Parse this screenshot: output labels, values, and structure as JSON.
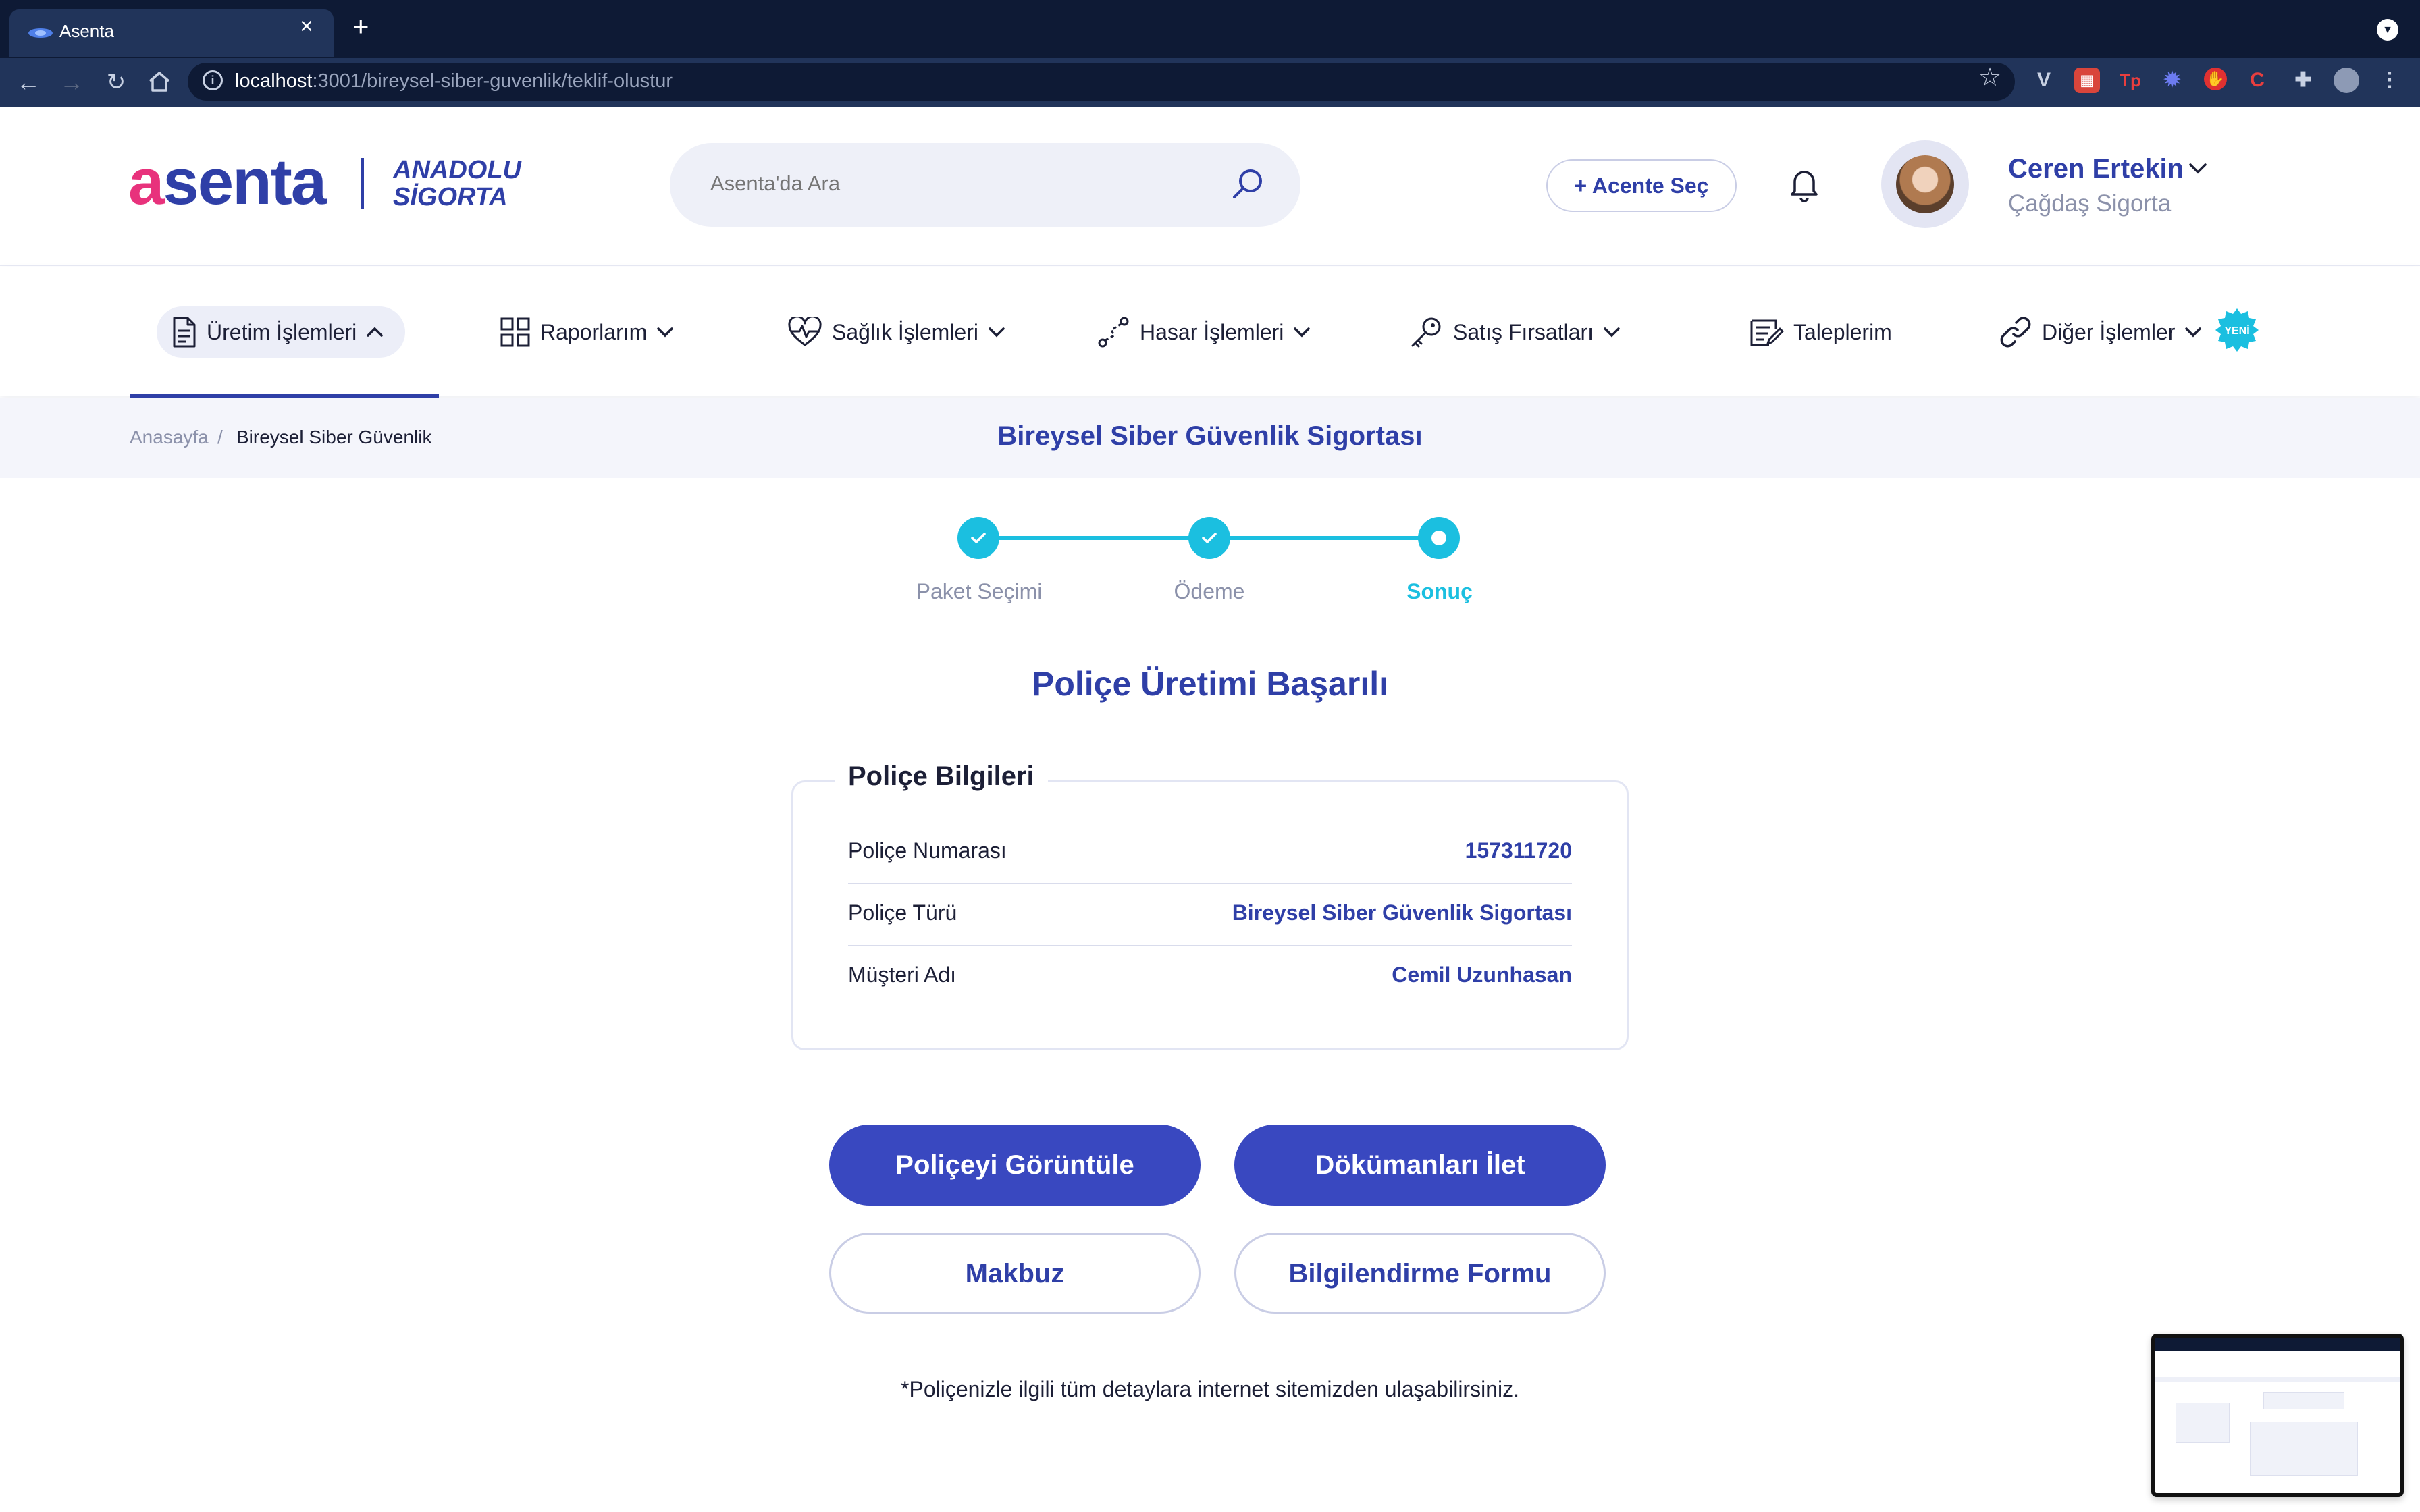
{
  "browser": {
    "tab_title": "Asenta",
    "tab_close": "×",
    "new_tab": "+",
    "url_host": "localhost",
    "url_path": ":3001/bireysel-siber-guvenlik/teklif-olustur"
  },
  "header": {
    "logo_text": "asenta",
    "partner_logo_line1": "ANADOLU",
    "partner_logo_line2": "SİGORTA",
    "search_placeholder": "Asenta'da Ara",
    "agent_button": "+ Acente Seç",
    "user_name": "Ceren Ertekin",
    "user_company": "Çağdaş Sigorta"
  },
  "nav": {
    "items": [
      {
        "label": "Üretim İşlemleri",
        "icon": "document-icon",
        "active": true
      },
      {
        "label": "Raporlarım",
        "icon": "grid-icon"
      },
      {
        "label": "Sağlık İşlemleri",
        "icon": "heart-pulse-icon"
      },
      {
        "label": "Hasar İşlemleri",
        "icon": "route-icon"
      },
      {
        "label": "Satış Fırsatları",
        "icon": "key-icon"
      },
      {
        "label": "Taleplerim",
        "icon": "note-edit-icon"
      },
      {
        "label": "Diğer İşlemler",
        "icon": "link-icon"
      }
    ],
    "new_badge": "YENİ"
  },
  "breadcrumb": {
    "home": "Anasayfa",
    "separator": "/",
    "current": "Bireysel Siber Güvenlik"
  },
  "page_title": "Bireysel Siber Güvenlik Sigortası",
  "stepper": {
    "steps": [
      {
        "label": "Paket Seçimi",
        "state": "done"
      },
      {
        "label": "Ödeme",
        "state": "done"
      },
      {
        "label": "Sonuç",
        "state": "current"
      }
    ]
  },
  "result": {
    "title": "Poliçe Üretimi Başarılı",
    "box_title": "Poliçe Bilgileri",
    "rows": [
      {
        "label": "Poliçe Numarası",
        "value": "157311720"
      },
      {
        "label": "Poliçe Türü",
        "value": "Bireysel Siber Güvenlik Sigortası"
      },
      {
        "label": "Müşteri Adı",
        "value": "Cemil Uzunhasan"
      }
    ]
  },
  "actions": {
    "view_policy": "Poliçeyi Görüntüle",
    "send_documents": "Dökümanları İlet",
    "receipt": "Makbuz",
    "info_form": "Bilgilendirme Formu"
  },
  "footnote": "*Poliçenizle ilgili tüm detaylara internet sitemizden ulaşabilirsiniz.",
  "colors": {
    "brand": "#2f3fa7",
    "accent": "#1bbfe0",
    "primary_button": "#3948c0",
    "chrome": "#0e1a35"
  }
}
